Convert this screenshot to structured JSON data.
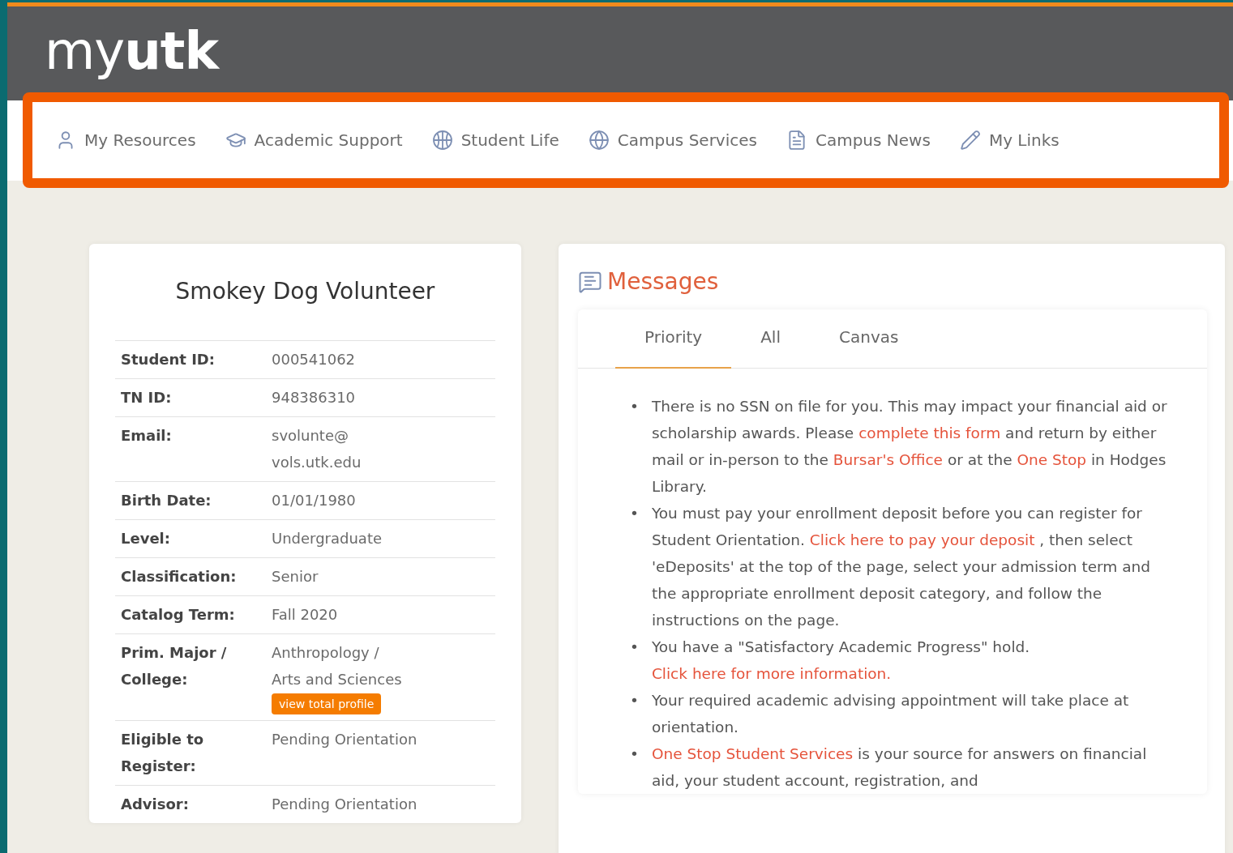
{
  "header": {
    "logo_light": "my",
    "logo_bold": "utk"
  },
  "nav": [
    {
      "kind": "person",
      "label": "My Resources"
    },
    {
      "kind": "cap",
      "label": "Academic Support"
    },
    {
      "kind": "ball",
      "label": "Student Life"
    },
    {
      "kind": "globe",
      "label": "Campus Services"
    },
    {
      "kind": "news",
      "label": "Campus News"
    },
    {
      "kind": "pencil",
      "label": "My Links"
    }
  ],
  "profile": {
    "name": "Smokey Dog Volunteer",
    "rows": [
      {
        "label": "Student ID:",
        "lines": [
          "000541062"
        ]
      },
      {
        "label": "TN ID:",
        "lines": [
          "948386310"
        ]
      },
      {
        "label": "Email:",
        "lines": [
          "svolunte@",
          "vols.utk.edu"
        ]
      },
      {
        "label": "Birth Date:",
        "lines": [
          "01/01/1980"
        ]
      },
      {
        "label": "Level:",
        "lines": [
          "Undergraduate"
        ]
      },
      {
        "label": "Classification:",
        "lines": [
          "Senior"
        ]
      },
      {
        "label": "Catalog Term:",
        "lines": [
          "Fall 2020"
        ]
      },
      {
        "label": "Prim. Major / College:",
        "lines": [
          "Anthropology /",
          "Arts and Sciences"
        ],
        "button": "view total profile"
      },
      {
        "label": "Eligible to Register:",
        "lines": [
          "Pending Orientation"
        ]
      },
      {
        "label": "Advisor:",
        "lines": [
          "Pending Orientation"
        ]
      }
    ]
  },
  "messages": {
    "title": "Messages",
    "tabs": [
      {
        "label": "Priority",
        "selected": true
      },
      {
        "label": "All",
        "selected": false
      },
      {
        "label": "Canvas",
        "selected": false
      }
    ],
    "items": [
      {
        "bullet": "•",
        "parts": [
          {
            "text": "There is no SSN on file for you. This may impact your financial aid or scholarship awards. Please ",
            "kind": "text"
          },
          {
            "text": "complete this form",
            "kind": "link"
          },
          {
            "text": " and return by either mail or in-person to the ",
            "kind": "text"
          },
          {
            "text": "Bursar's Office",
            "kind": "link"
          },
          {
            "text": " or at the ",
            "kind": "text"
          },
          {
            "text": "One Stop",
            "kind": "link"
          },
          {
            "text": " in Hodges Library.",
            "kind": "text"
          }
        ]
      },
      {
        "bullet": "•",
        "parts": [
          {
            "text": "You must pay your enrollment deposit before you can register for Student Orientation. ",
            "kind": "text"
          },
          {
            "text": "Click here to pay your deposit",
            "kind": "link"
          },
          {
            "text": " , then select 'eDeposits' at the top of the page, select your admission term and the appropriate enrollment deposit category, and follow the instructions on the page.",
            "kind": "text"
          }
        ]
      },
      {
        "bullet": "•",
        "parts": [
          {
            "text": "You have a \"Satisfactory Academic Progress\" hold. ",
            "kind": "text"
          },
          {
            "text": "Click here for more information.",
            "kind": "link"
          }
        ]
      },
      {
        "bullet": "•",
        "parts": [
          {
            "text": "Your required academic advising appointment will take place at orientation.",
            "kind": "text"
          }
        ]
      },
      {
        "bullet": "•",
        "parts": [
          {
            "text": "One Stop Student Services",
            "kind": "link"
          },
          {
            "text": " is your source for answers on financial aid, your student account, registration, and",
            "kind": "text"
          }
        ]
      }
    ]
  }
}
